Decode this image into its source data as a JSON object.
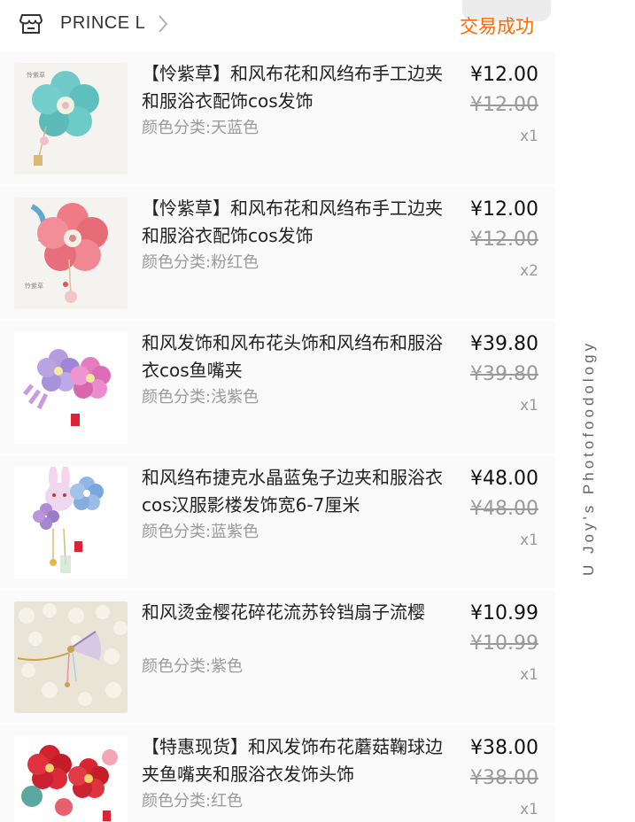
{
  "header": {
    "shop_name": "PRINCE L",
    "status": "交易成功",
    "status_color": "#ff6a00",
    "shop_icon": "store-icon",
    "chevron_icon": "chevron-right-icon"
  },
  "items": [
    {
      "title": "【怜紫草】和风布花和风绉布手工边夹和服浴衣配饰cos发饰",
      "spec": "颜色分类:天蓝色",
      "price": "¥12.00",
      "original_price": "¥12.00",
      "quantity": "x1"
    },
    {
      "title": "【怜紫草】和风布花和风绉布手工边夹和服浴衣配饰cos发饰",
      "spec": "颜色分类:粉红色",
      "price": "¥12.00",
      "original_price": "¥12.00",
      "quantity": "x2"
    },
    {
      "title": "和风发饰和风布花头饰和风绉布和服浴衣cos鱼嘴夹",
      "spec": "颜色分类:浅紫色",
      "price": "¥39.80",
      "original_price": "¥39.80",
      "quantity": "x1"
    },
    {
      "title": "和风绉布捷克水晶蓝兔子边夹和服浴衣cos汉服影楼发饰宽6-7厘米",
      "spec": "颜色分类:蓝紫色",
      "price": "¥48.00",
      "original_price": "¥48.00",
      "quantity": "x1"
    },
    {
      "title": "和风烫金樱花碎花流苏铃铛扇子流樱",
      "spec": "颜色分类:紫色",
      "price": "¥10.99",
      "original_price": "¥10.99",
      "quantity": "x1"
    },
    {
      "title": "【特惠现货】和风发饰布花蘑菇鞠球边夹鱼嘴夹和服浴衣发饰头饰",
      "spec": "颜色分类:红色",
      "price": "¥38.00",
      "original_price": "¥38.00",
      "quantity": "x1"
    }
  ],
  "watermark": "U Joy's Photofoodology"
}
